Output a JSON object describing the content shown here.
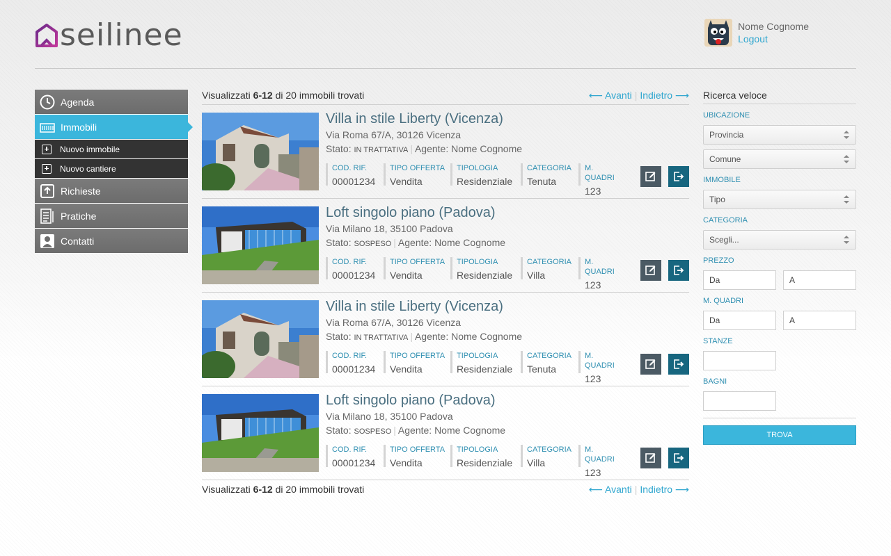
{
  "brand": {
    "name": "seilinee"
  },
  "user": {
    "name": "Nome Cognome",
    "logout": "Logout"
  },
  "sidebar": {
    "items": [
      {
        "label": "Agenda",
        "icon": "clock-icon"
      },
      {
        "label": "Immobili",
        "icon": "building-icon",
        "active": true
      },
      {
        "label": "Nuovo immobile",
        "icon": "plus-icon"
      },
      {
        "label": "Nuovo cantiere",
        "icon": "plus-icon"
      },
      {
        "label": "Richieste",
        "icon": "upload-icon"
      },
      {
        "label": "Pratiche",
        "icon": "document-icon"
      },
      {
        "label": "Contatti",
        "icon": "person-icon"
      }
    ]
  },
  "results": {
    "prefix": "Visualizzati",
    "range": "6-12",
    "suffix": "di 20 immobili trovati",
    "next": "⟵ Avanti",
    "prev": "Indietro ⟶"
  },
  "field_labels": {
    "ref": "COD. RIF.",
    "offer": "TIPO OFFERTA",
    "type": "TIPOLOGIA",
    "category": "CATEGORIA",
    "sqm": "M. QUADRI"
  },
  "listings": [
    {
      "title": "Villa in stile Liberty (Vicenza)",
      "address": "Via Roma 67/A, 30126 Vicenza",
      "state_label": "Stato:",
      "state": "IN TRATTATIVA",
      "agent": "Agente: Nome Cognome",
      "ref": "00001234",
      "offer": "Vendita",
      "type": "Residenziale",
      "category": "Tenuta",
      "sqm": "123"
    },
    {
      "title": "Loft singolo piano (Padova)",
      "address": "Via Milano 18, 35100 Padova",
      "state_label": "Stato:",
      "state": "SOSPESO",
      "agent": "Agente: Nome Cognome",
      "ref": "00001234",
      "offer": "Vendita",
      "type": "Residenziale",
      "category": "Villa",
      "sqm": "123"
    },
    {
      "title": "Villa in stile Liberty (Vicenza)",
      "address": "Via Roma 67/A, 30126 Vicenza",
      "state_label": "Stato:",
      "state": "IN TRATTATIVA",
      "agent": "Agente: Nome Cognome",
      "ref": "00001234",
      "offer": "Vendita",
      "type": "Residenziale",
      "category": "Tenuta",
      "sqm": "123"
    },
    {
      "title": "Loft singolo piano (Padova)",
      "address": "Via Milano 18, 35100 Padova",
      "state_label": "Stato:",
      "state": "SOSPESO",
      "agent": "Agente: Nome Cognome",
      "ref": "00001234",
      "offer": "Vendita",
      "type": "Residenziale",
      "category": "Villa",
      "sqm": "123"
    }
  ],
  "search": {
    "title": "Ricerca veloce",
    "location_label": "UBICAZIONE",
    "provincia": "Provincia",
    "comune": "Comune",
    "property_label": "IMMOBILE",
    "tipo": "Tipo",
    "category_label": "CATEGORIA",
    "category_select": "Scegli...",
    "price_label": "PREZZO",
    "from": "Da",
    "to": "A",
    "sqm_label": "M. QUADRI",
    "rooms_label": "STANZE",
    "baths_label": "BAGNI",
    "submit": "TROVA"
  },
  "colors": {
    "accent": "#3bb6dc",
    "dark_button": "#17667f",
    "edit_button": "#4b5a64",
    "sidebar": "#6c6c6c",
    "title": "#4a6f80"
  }
}
